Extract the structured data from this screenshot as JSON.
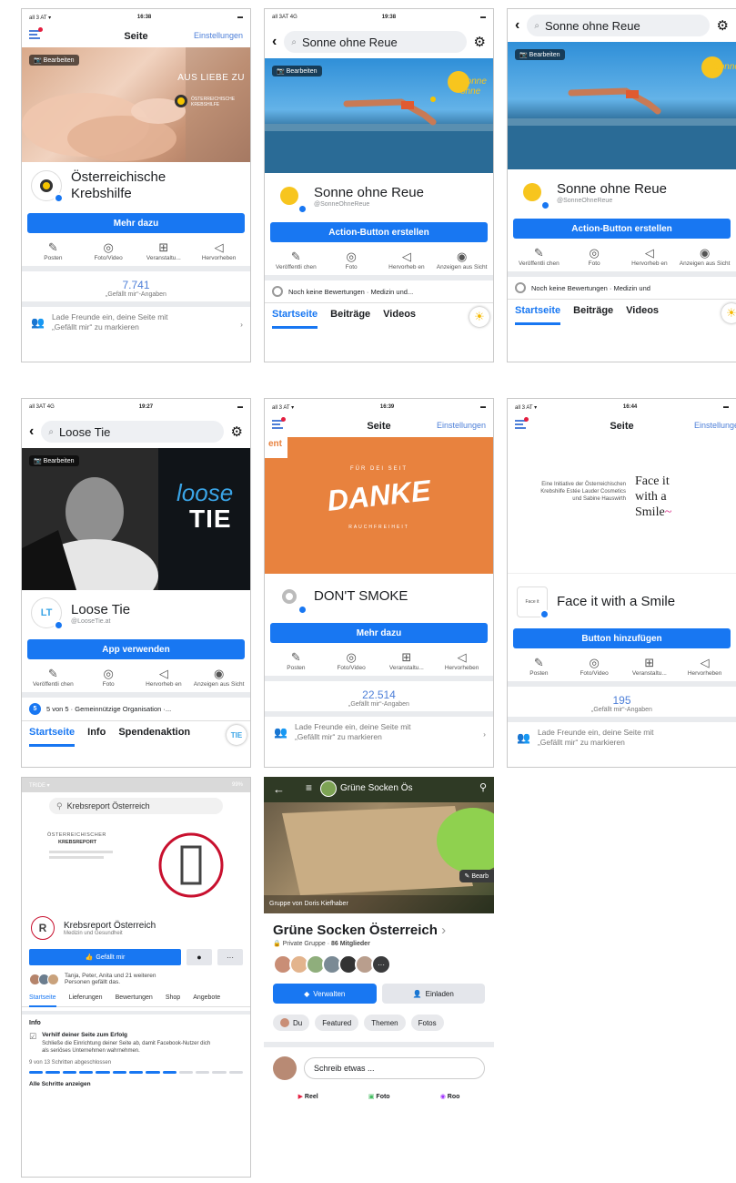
{
  "p1": {
    "status": {
      "left": "all 3 AT ▾",
      "time": "16:38",
      "right": "▬"
    },
    "nav_title": "Seite",
    "nav_settings": "Einstellungen",
    "edit": "Bearbeiten",
    "cover_text": "AUS LIEBE ZU",
    "cover_logo_text": "ÖSTERREICHISCHE KREBSHILFE",
    "name_line1": "Österreichische",
    "name_line2": "Krebshilfe",
    "cta": "Mehr dazu",
    "actions": [
      {
        "icon": "✎",
        "label": "Posten"
      },
      {
        "icon": "◎",
        "label": "Foto/Video"
      },
      {
        "icon": "⊞",
        "label": "Veranstaltu..."
      },
      {
        "icon": "◁",
        "label": "Hervorheben"
      }
    ],
    "likes": "7.741",
    "likes_label": "„Gefällt mir“-Angaben",
    "invite_line1": "Lade Freunde ein, deine Seite mit",
    "invite_line2": "„Gefällt mir“ zu markieren",
    "invite_arrow": "›"
  },
  "p2": {
    "status": {
      "left": "all 3AT 4G",
      "time": "19:38",
      "right": "▬"
    },
    "back": "‹",
    "search": "Sonne ohne Reue",
    "search_icon": "⌕",
    "gear": "⚙",
    "edit": "Bearbeiten",
    "cover_brand": "Sonne ohne",
    "name": "Sonne ohne Reue",
    "handle": "@SonneOhneReue",
    "cta": "Action-Button erstellen",
    "actions": [
      {
        "icon": "✎",
        "label": "Veröffentli chen"
      },
      {
        "icon": "◎",
        "label": "Foto"
      },
      {
        "icon": "◁",
        "label": "Hervorheb en"
      },
      {
        "icon": "◉",
        "label": "Anzeigen aus Sicht"
      }
    ],
    "review": "Noch keine Bewertungen · Medizin und...",
    "tabs": [
      "Startseite",
      "Beiträge",
      "Videos"
    ]
  },
  "p3": {
    "back": "‹",
    "search": "Sonne ohne Reue",
    "search_icon": "⌕",
    "gear": "⚙",
    "edit": "Bearbeiten",
    "cover_brand": "Sonne",
    "name": "Sonne ohne Reue",
    "handle": "@SonneOhneReue",
    "cta": "Action-Button erstellen",
    "actions": [
      {
        "icon": "✎",
        "label": "Veröffentli chen"
      },
      {
        "icon": "◎",
        "label": "Foto"
      },
      {
        "icon": "◁",
        "label": "Hervorheb en"
      },
      {
        "icon": "◉",
        "label": "Anzeigen aus Sicht"
      }
    ],
    "review": "Noch keine Bewertungen · Medizin und",
    "tabs": [
      "Startseite",
      "Beiträge",
      "Videos"
    ]
  },
  "p4": {
    "status": {
      "left": "all 3AT 4G",
      "time": "19:27",
      "right": "▬"
    },
    "back": "‹",
    "search": "Loose Tie",
    "search_icon": "⌕",
    "gear": "⚙",
    "edit": "Bearbeiten",
    "cover_logo1": "loose",
    "cover_logo2": "TIE",
    "name": "Loose Tie",
    "handle": "@LooseTie.at",
    "cta": "App verwenden",
    "actions": [
      {
        "icon": "✎",
        "label": "Veröffentli chen"
      },
      {
        "icon": "◎",
        "label": "Foto"
      },
      {
        "icon": "◁",
        "label": "Hervorheb en"
      },
      {
        "icon": "◉",
        "label": "Anzeigen aus Sicht"
      }
    ],
    "rating_num": "5",
    "review": "5 von 5 · Gemeinnützige Organisation ·...",
    "tabs": [
      "Startseite",
      "Info",
      "Spendenaktion"
    ]
  },
  "p5": {
    "status": {
      "left": "all 3 AT ▾",
      "time": "16:39",
      "right": "▬"
    },
    "nav_title": "Seite",
    "nav_settings": "Einstellungen",
    "sticker": "ent",
    "cover_small_top": "FÜR DEI SEIT",
    "cover_main": "DANKE",
    "cover_small_bottom": "RAUCHFREIHEIT",
    "name": "DON'T SMOKE",
    "cta": "Mehr dazu",
    "actions": [
      {
        "icon": "✎",
        "label": "Posten"
      },
      {
        "icon": "◎",
        "label": "Foto/Video"
      },
      {
        "icon": "⊞",
        "label": "Veranstaltu..."
      },
      {
        "icon": "◁",
        "label": "Hervorheben"
      }
    ],
    "likes": "22.514",
    "likes_label": "„Gefällt mir“-Angaben",
    "invite_line1": "Lade Freunde ein, deine Seite mit",
    "invite_line2": "„Gefällt mir“ zu markieren",
    "invite_arrow": "›"
  },
  "p6": {
    "status": {
      "left": "all 3 AT ▾",
      "time": "16:44",
      "right": "▬"
    },
    "nav_title": "Seite",
    "nav_settings": "Einstellungen",
    "cover_text_left": "Eine Initiative der Österreichischen Krebshilfe Estée Lauder Cosmetics und Sabine Hauswirth",
    "cover_face1": "Face it",
    "cover_face2": "with a",
    "cover_face3": "Smile",
    "name": "Face it with a Smile",
    "cta": "Button hinzufügen",
    "actions": [
      {
        "icon": "✎",
        "label": "Posten"
      },
      {
        "icon": "◎",
        "label": "Foto/Video"
      },
      {
        "icon": "⊞",
        "label": "Veranstaltu..."
      },
      {
        "icon": "◁",
        "label": "Hervorheben"
      }
    ],
    "likes": "195",
    "likes_label": "„Gefällt mir“-Angaben",
    "invite_line1": "Lade Freunde ein, deine Seite mit",
    "invite_line2": "„Gefällt mir“ zu markieren"
  },
  "p7": {
    "status_left": "TRIDE ▾",
    "status_right": "99%",
    "search": "Krebsreport Österreich",
    "cover_title1": "ÖSTERREICHISCHER",
    "cover_title2": "KREBSREPORT",
    "name": "Krebsreport Österreich",
    "category": "Medizin und Gesundheit",
    "like_btn": "Gefällt mir",
    "msg_icon": "●",
    "more": "···",
    "friends_line1": "Tanja, Peter, Anita und 21 weiteren",
    "friends_line2": "Personen gefällt das.",
    "tabs": [
      "Startseite",
      "Lieferungen",
      "Bewertungen",
      "Shop",
      "Angebote"
    ],
    "info_title": "Info",
    "tip_title": "Verhilf deiner Seite zum Erfolg",
    "tip_text": "Schließe die Einrichtung deiner Seite ab, damit Facebook-Nutzer dich als seriöses Unternehmen wahrnehmen.",
    "progress_text": "9 von 13 Schritten abgeschlossen",
    "progress": 0.69,
    "all_steps": "Alle Schritte anzeigen"
  },
  "p8": {
    "header_title": "Grüne Socken Ös",
    "cover_caption": "Gruppe von Doris Kiefhaber",
    "edit": "Bearb",
    "title": "Grüne Socken Österreich",
    "title_arrow": "›",
    "sub_private": "Private Gruppe",
    "sub_members": "86 Mitglieder",
    "manage_btn": "Verwalten",
    "invite_btn": "Einladen",
    "chips": [
      "Du",
      "Featured",
      "Themen",
      "Fotos"
    ],
    "composer": "Schreib etwas ...",
    "bottom": [
      "Reel",
      "Foto",
      "Roo"
    ]
  }
}
